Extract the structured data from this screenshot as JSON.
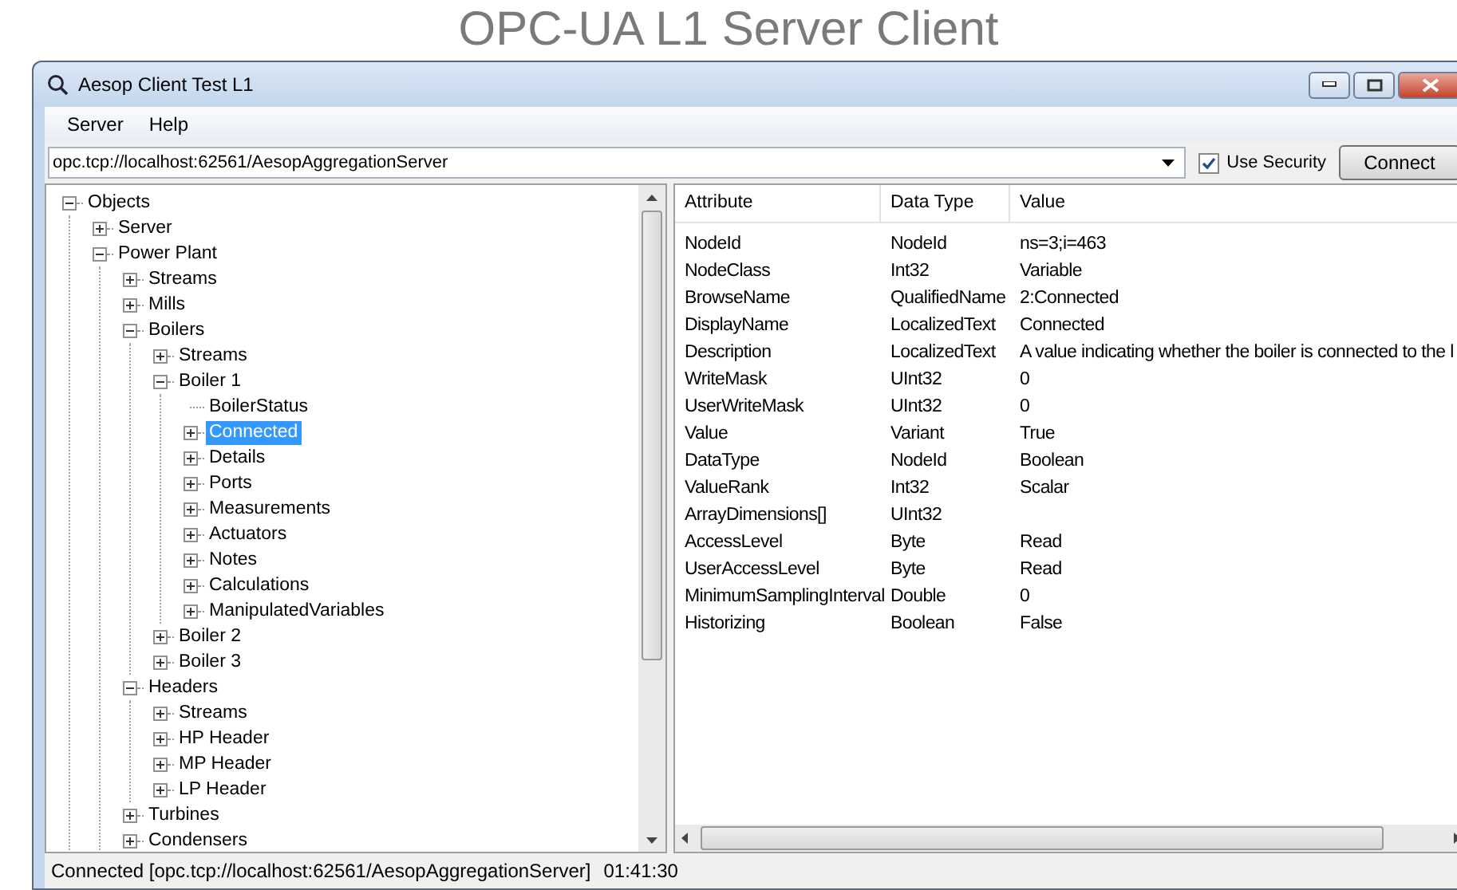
{
  "slide_title": "OPC-UA L1 Server Client",
  "window": {
    "title": "Aesop Client Test L1"
  },
  "menu": [
    "Server",
    "Help"
  ],
  "endpoint": {
    "value": "opc.tcp://localhost:62561/AesopAggregationServer"
  },
  "use_security": {
    "label": "Use Security",
    "checked": true
  },
  "connect_button": "Connect",
  "tree": [
    {
      "label": "Objects",
      "kind": "branch",
      "expanded": true,
      "selected": false,
      "children": [
        {
          "label": "Server",
          "kind": "branch",
          "expanded": false,
          "selected": false
        },
        {
          "label": "Power Plant",
          "kind": "branch",
          "expanded": true,
          "selected": false,
          "children": [
            {
              "label": "Streams",
              "kind": "branch",
              "expanded": false,
              "selected": false
            },
            {
              "label": "Mills",
              "kind": "branch",
              "expanded": false,
              "selected": false
            },
            {
              "label": "Boilers",
              "kind": "branch",
              "expanded": true,
              "selected": false,
              "children": [
                {
                  "label": "Streams",
                  "kind": "branch",
                  "expanded": false,
                  "selected": false
                },
                {
                  "label": "Boiler 1",
                  "kind": "branch",
                  "expanded": true,
                  "selected": false,
                  "children": [
                    {
                      "label": "BoilerStatus",
                      "kind": "leaf",
                      "expanded": false,
                      "selected": false
                    },
                    {
                      "label": "Connected",
                      "kind": "branch",
                      "expanded": false,
                      "selected": true
                    },
                    {
                      "label": "Details",
                      "kind": "branch",
                      "expanded": false,
                      "selected": false
                    },
                    {
                      "label": "Ports",
                      "kind": "branch",
                      "expanded": false,
                      "selected": false
                    },
                    {
                      "label": "Measurements",
                      "kind": "branch",
                      "expanded": false,
                      "selected": false
                    },
                    {
                      "label": "Actuators",
                      "kind": "branch",
                      "expanded": false,
                      "selected": false
                    },
                    {
                      "label": "Notes",
                      "kind": "branch",
                      "expanded": false,
                      "selected": false
                    },
                    {
                      "label": "Calculations",
                      "kind": "branch",
                      "expanded": false,
                      "selected": false
                    },
                    {
                      "label": "ManipulatedVariables",
                      "kind": "branch",
                      "expanded": false,
                      "selected": false
                    }
                  ]
                },
                {
                  "label": "Boiler 2",
                  "kind": "branch",
                  "expanded": false,
                  "selected": false
                },
                {
                  "label": "Boiler 3",
                  "kind": "branch",
                  "expanded": false,
                  "selected": false
                }
              ]
            },
            {
              "label": "Headers",
              "kind": "branch",
              "expanded": true,
              "selected": false,
              "children": [
                {
                  "label": "Streams",
                  "kind": "branch",
                  "expanded": false,
                  "selected": false
                },
                {
                  "label": "HP Header",
                  "kind": "branch",
                  "expanded": false,
                  "selected": false
                },
                {
                  "label": "MP Header",
                  "kind": "branch",
                  "expanded": false,
                  "selected": false
                },
                {
                  "label": "LP Header",
                  "kind": "branch",
                  "expanded": false,
                  "selected": false
                }
              ]
            },
            {
              "label": "Turbines",
              "kind": "branch",
              "expanded": false,
              "selected": false
            },
            {
              "label": "Condensers",
              "kind": "branch",
              "expanded": false,
              "selected": false
            }
          ]
        }
      ]
    }
  ],
  "table": {
    "columns": [
      "Attribute",
      "Data Type",
      "Value"
    ],
    "rows": [
      [
        "NodeId",
        "NodeId",
        "ns=3;i=463"
      ],
      [
        "NodeClass",
        "Int32",
        "Variable"
      ],
      [
        "BrowseName",
        "QualifiedName",
        "2:Connected"
      ],
      [
        "DisplayName",
        "LocalizedText",
        "Connected"
      ],
      [
        "Description",
        "LocalizedText",
        "A value indicating whether the boiler is connected to the l"
      ],
      [
        "WriteMask",
        "UInt32",
        "0"
      ],
      [
        "UserWriteMask",
        "UInt32",
        "0"
      ],
      [
        "Value",
        "Variant",
        "True"
      ],
      [
        "DataType",
        "NodeId",
        "Boolean"
      ],
      [
        "ValueRank",
        "Int32",
        "Scalar"
      ],
      [
        "ArrayDimensions[]",
        "UInt32",
        ""
      ],
      [
        "AccessLevel",
        "Byte",
        "Read"
      ],
      [
        "UserAccessLevel",
        "Byte",
        "Read"
      ],
      [
        "MinimumSamplingInterval",
        "Double",
        "0"
      ],
      [
        "Historizing",
        "Boolean",
        "False"
      ]
    ]
  },
  "status_bar": {
    "text": "Connected [opc.tcp://localhost:62561/AesopAggregationServer]",
    "time": "01:41:30"
  }
}
